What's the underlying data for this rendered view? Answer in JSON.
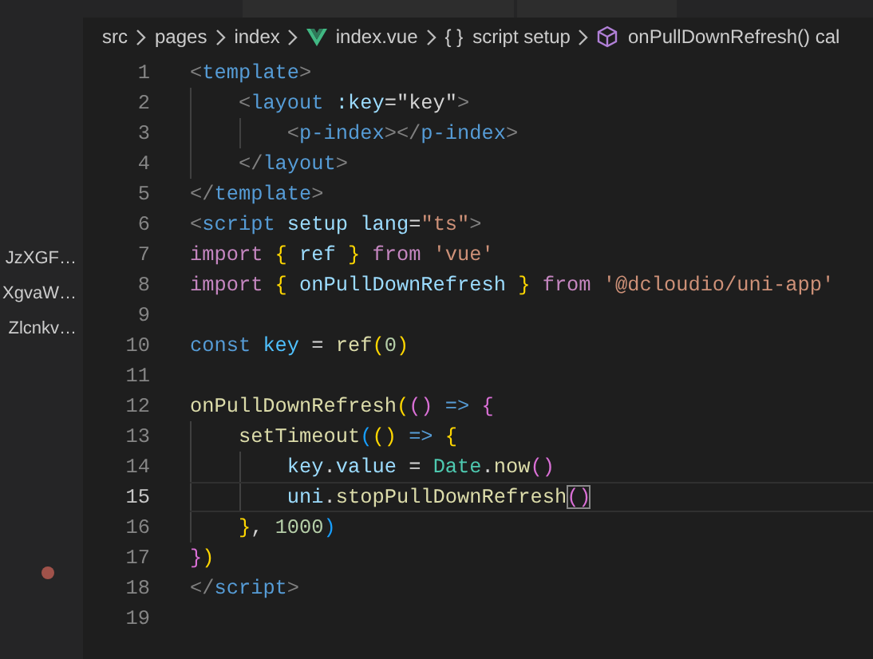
{
  "sidebar": {
    "items": [
      {
        "label": "JzXGF…"
      },
      {
        "label": "XgvaW…"
      },
      {
        "label": "Zlcnkv…"
      }
    ]
  },
  "breadcrumb": [
    {
      "kind": "folder",
      "label": "src"
    },
    {
      "kind": "folder",
      "label": "pages"
    },
    {
      "kind": "folder",
      "label": "index"
    },
    {
      "kind": "vue-file",
      "label": "index.vue"
    },
    {
      "kind": "braces",
      "icon": "{ }",
      "label": "script setup"
    },
    {
      "kind": "method",
      "label": "onPullDownRefresh() cal"
    }
  ],
  "editor": {
    "lines": [
      {
        "number": "1",
        "current": false,
        "tokens": [
          {
            "kind": "punct",
            "text": "<"
          },
          {
            "kind": "tag",
            "text": "template"
          },
          {
            "kind": "punct",
            "text": ">"
          }
        ]
      },
      {
        "number": "2",
        "current": false,
        "tokens": [
          {
            "kind": "punct",
            "text": "    <"
          },
          {
            "kind": "tag",
            "text": "layout"
          },
          {
            "kind": "attr",
            "text": " :key"
          },
          {
            "kind": "plain",
            "text": "=\"key\""
          },
          {
            "kind": "punct",
            "text": ">"
          }
        ]
      },
      {
        "number": "3",
        "current": false,
        "tokens": [
          {
            "kind": "punct",
            "text": "        <"
          },
          {
            "kind": "tag",
            "text": "p-index"
          },
          {
            "kind": "punct",
            "text": "></"
          },
          {
            "kind": "tag",
            "text": "p-index"
          },
          {
            "kind": "punct",
            "text": ">"
          }
        ]
      },
      {
        "number": "4",
        "current": false,
        "tokens": [
          {
            "kind": "punct",
            "text": "    </"
          },
          {
            "kind": "tag",
            "text": "layout"
          },
          {
            "kind": "punct",
            "text": ">"
          }
        ]
      },
      {
        "number": "5",
        "current": false,
        "tokens": [
          {
            "kind": "punct",
            "text": "</"
          },
          {
            "kind": "tag",
            "text": "template"
          },
          {
            "kind": "punct",
            "text": ">"
          }
        ]
      },
      {
        "number": "6",
        "current": false,
        "tokens": [
          {
            "kind": "punct",
            "text": "<"
          },
          {
            "kind": "tag",
            "text": "script"
          },
          {
            "kind": "attr",
            "text": " setup lang"
          },
          {
            "kind": "plain",
            "text": "="
          },
          {
            "kind": "string",
            "text": "\"ts\""
          },
          {
            "kind": "punct",
            "text": ">"
          }
        ]
      },
      {
        "number": "7",
        "current": false,
        "tokens": [
          {
            "kind": "control",
            "text": "import"
          },
          {
            "kind": "bracket1",
            "text": " {"
          },
          {
            "kind": "variable",
            "text": " ref"
          },
          {
            "kind": "bracket1",
            "text": " }"
          },
          {
            "kind": "control",
            "text": " from"
          },
          {
            "kind": "string",
            "text": " 'vue'"
          }
        ]
      },
      {
        "number": "8",
        "current": false,
        "tokens": [
          {
            "kind": "control",
            "text": "import"
          },
          {
            "kind": "bracket1",
            "text": " {"
          },
          {
            "kind": "variable",
            "text": " onPullDownRefresh"
          },
          {
            "kind": "bracket1",
            "text": " }"
          },
          {
            "kind": "control",
            "text": " from"
          },
          {
            "kind": "string",
            "text": " '@dcloudio/uni-app'"
          }
        ]
      },
      {
        "number": "9",
        "current": false
      },
      {
        "number": "10",
        "current": false,
        "tokens": [
          {
            "kind": "keyword",
            "text": "const"
          },
          {
            "kind": "constant",
            "text": " key"
          },
          {
            "kind": "plain",
            "text": " ="
          },
          {
            "kind": "function",
            "text": " ref"
          },
          {
            "kind": "bracket1",
            "text": "("
          },
          {
            "kind": "number",
            "text": "0"
          },
          {
            "kind": "bracket1",
            "text": ")"
          }
        ]
      },
      {
        "number": "11",
        "current": false
      },
      {
        "number": "12",
        "current": false,
        "tokens": [
          {
            "kind": "function",
            "text": "onPullDownRefresh"
          },
          {
            "kind": "bracket1",
            "text": "("
          },
          {
            "kind": "bracket2",
            "text": "()"
          },
          {
            "kind": "keyword",
            "text": " =>"
          },
          {
            "kind": "bracket2",
            "text": " {"
          }
        ]
      },
      {
        "number": "13",
        "current": false,
        "tokens": [
          {
            "kind": "function",
            "text": "    setTimeout"
          },
          {
            "kind": "bracket3",
            "text": "("
          },
          {
            "kind": "bracket1",
            "text": "()"
          },
          {
            "kind": "keyword",
            "text": " =>"
          },
          {
            "kind": "bracket1",
            "text": " {"
          }
        ]
      },
      {
        "number": "14",
        "current": false,
        "tokens": [
          {
            "kind": "variable",
            "text": "        key"
          },
          {
            "kind": "plain",
            "text": "."
          },
          {
            "kind": "variable",
            "text": "value"
          },
          {
            "kind": "plain",
            "text": " ="
          },
          {
            "kind": "class",
            "text": " Date"
          },
          {
            "kind": "plain",
            "text": "."
          },
          {
            "kind": "function",
            "text": "now"
          },
          {
            "kind": "bracket2",
            "text": "()"
          }
        ]
      },
      {
        "number": "15",
        "current": true,
        "tokens": [
          {
            "kind": "variable",
            "text": "        uni"
          },
          {
            "kind": "plain",
            "text": "."
          },
          {
            "kind": "function",
            "text": "stopPullDownRefresh"
          },
          {
            "kind": "match",
            "text": "()"
          }
        ]
      },
      {
        "number": "16",
        "current": false,
        "tokens": [
          {
            "kind": "bracket1",
            "text": "    }"
          },
          {
            "kind": "plain",
            "text": ","
          },
          {
            "kind": "number",
            "text": " 1000"
          },
          {
            "kind": "bracket3",
            "text": ")"
          }
        ]
      },
      {
        "number": "17",
        "current": false,
        "tokens": [
          {
            "kind": "bracket2",
            "text": "}"
          },
          {
            "kind": "bracket1",
            "text": ")"
          }
        ]
      },
      {
        "number": "18",
        "current": false,
        "tokens": [
          {
            "kind": "punct",
            "text": "</"
          },
          {
            "kind": "tag",
            "text": "script"
          },
          {
            "kind": "punct",
            "text": ">"
          }
        ]
      },
      {
        "number": "19",
        "current": false
      }
    ]
  }
}
